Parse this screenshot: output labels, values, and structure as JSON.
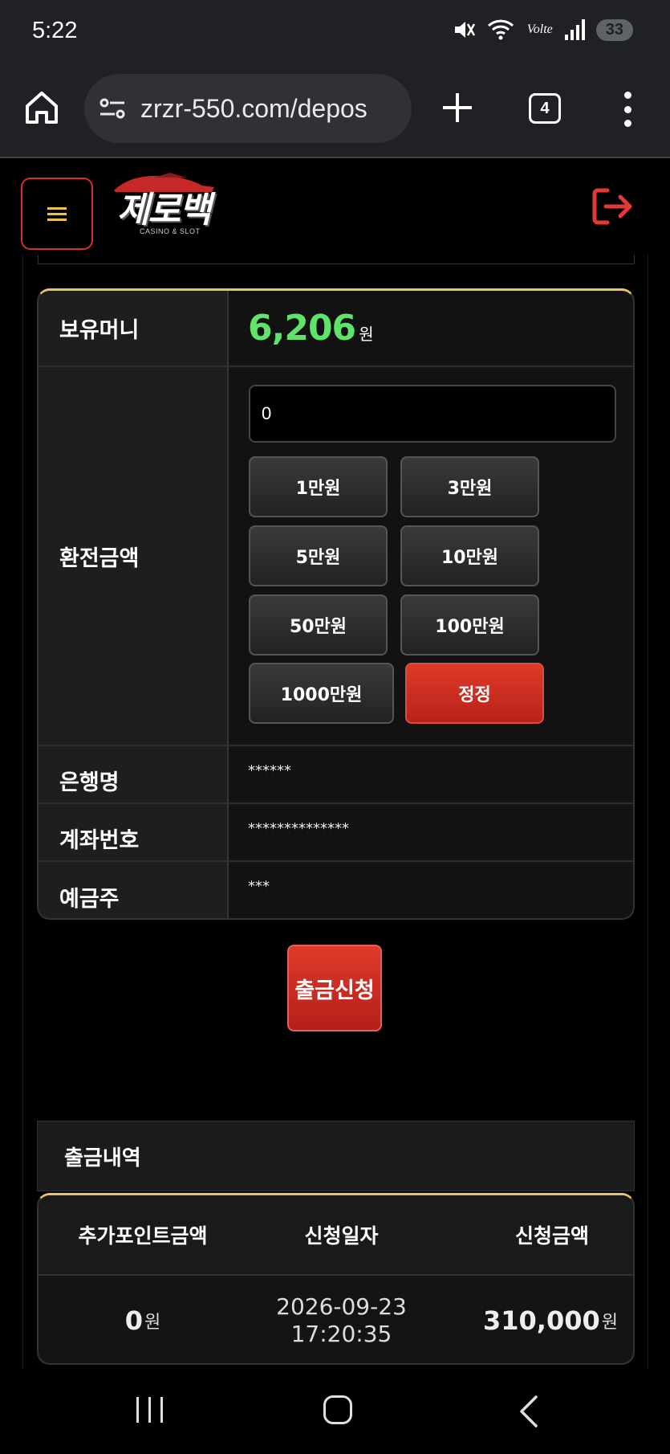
{
  "status": {
    "time": "5:22",
    "network": "Volte",
    "battery": "33"
  },
  "browser": {
    "url": "zrzr-550.com/depos",
    "tab_count": "4"
  },
  "site": {
    "logo_text": "제로백",
    "logo_sub": "CASINO & SLOT"
  },
  "form": {
    "balance_label": "보유머니",
    "balance_value": "6,206",
    "balance_unit": "원",
    "amount_label": "환전금액",
    "amount_value": "0",
    "amount_buttons": [
      "1만원",
      "3만원",
      "5만원",
      "10만원",
      "50만원",
      "100만원",
      "1000만원"
    ],
    "reset_label": "정정",
    "bank_label": "은행명",
    "bank_value": "******",
    "account_label": "계좌번호",
    "account_value": "**************",
    "holder_label": "예금주",
    "holder_value": "***"
  },
  "submit_label": "출금신청",
  "history": {
    "title": "출금내역",
    "columns": [
      "추가포인트금액",
      "신청일자",
      "신청금액"
    ],
    "rows": [
      {
        "bonus": "0",
        "bonus_unit": "원",
        "date": "2026-09-23",
        "time": "17:20:35",
        "amount": "310,000",
        "amount_unit": "원"
      }
    ]
  }
}
